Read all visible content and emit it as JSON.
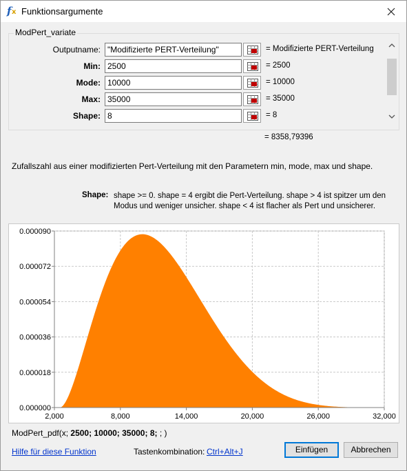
{
  "window": {
    "title": "Funktionsargumente",
    "icon": "function-fx-icon"
  },
  "function_group": {
    "name": "ModPert_variate",
    "params": [
      {
        "label": "Outputname:",
        "bold": false,
        "value": "\"Modifizierte PERT-Verteilung\"",
        "result": "= Modifizierte PERT-Verteilung"
      },
      {
        "label": "Min:",
        "bold": true,
        "value": "2500",
        "result": "= 2500"
      },
      {
        "label": "Mode:",
        "bold": true,
        "value": "10000",
        "result": "= 10000"
      },
      {
        "label": "Max:",
        "bold": true,
        "value": "35000",
        "result": "= 35000"
      },
      {
        "label": "Shape:",
        "bold": true,
        "value": "8",
        "result": "= 8"
      }
    ]
  },
  "overall_result": "=  8358,79396",
  "description": "Zufallszahl aus einer modifizierten Pert-Verteilung mit den Parametern min, mode, max und shape.",
  "param_help": {
    "label": "Shape:",
    "text": "shape >= 0. shape = 4 ergibt die Pert-Verteilung. shape > 4 ist spitzer um den Modus und weniger unsicher. shape < 4 ist flacher als Pert und unsicherer."
  },
  "chart_data": {
    "type": "area",
    "color": "#ff8000",
    "xlim": [
      0,
      32000
    ],
    "ylim": [
      0,
      9e-05
    ],
    "x_ticks": [
      2000,
      8000,
      14000,
      20000,
      26000,
      32000
    ],
    "x_tick_labels": [
      "2,000",
      "8,000",
      "14,000",
      "20,000",
      "26,000",
      "32,000"
    ],
    "y_ticks": [
      0,
      1.8e-05,
      3.6e-05,
      5.4e-05,
      7.2e-05,
      9e-05
    ],
    "y_tick_labels": [
      "0.000000",
      "0.000018",
      "0.000036",
      "0.000054",
      "0.000072",
      "0.000090"
    ],
    "grid": true,
    "distribution": {
      "min": 2500,
      "mode": 10000,
      "max": 35000,
      "shape": 8
    }
  },
  "formula": {
    "name": "ModPert_pdf(x;",
    "args_bold": "2500; 10000; 35000; 8;",
    "tail": "; )"
  },
  "footer": {
    "help_link": "Hilfe für diese Funktion",
    "shortcut_label": "Tastenkombination:",
    "shortcut_value": "Ctrl+Alt+J",
    "insert_button": "Einfügen",
    "cancel_button": "Abbrechen"
  }
}
